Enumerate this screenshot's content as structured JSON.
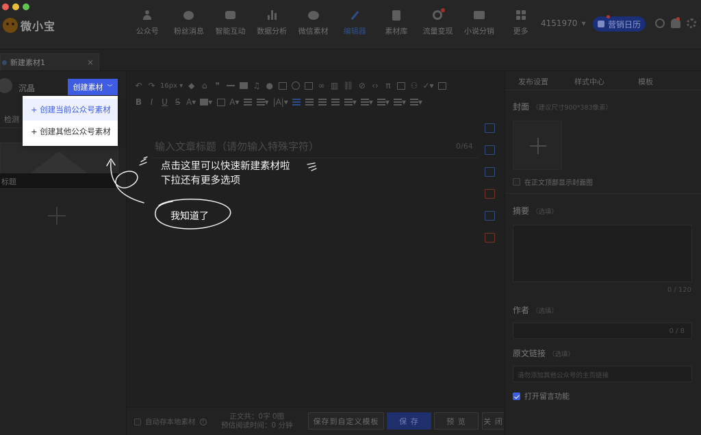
{
  "app": {
    "logo_text": "微小宝",
    "nav": [
      {
        "label": "公众号",
        "icon": "person-icon"
      },
      {
        "label": "粉丝消息",
        "icon": "bubble-icon"
      },
      {
        "label": "智能互动",
        "icon": "chat-icon"
      },
      {
        "label": "数据分析",
        "icon": "bar-chart-icon"
      },
      {
        "label": "微信素材",
        "icon": "wechat-icon"
      },
      {
        "label": "编辑器",
        "icon": "pen-icon",
        "active": true
      },
      {
        "label": "素材库",
        "icon": "book-icon"
      },
      {
        "label": "流量变现",
        "icon": "money-icon"
      },
      {
        "label": "小说分销",
        "icon": "open-book-icon"
      },
      {
        "label": "更多",
        "icon": "grid-icon"
      }
    ],
    "account_id": "4151970",
    "calendar_label": "营销日历"
  },
  "tabs": {
    "doc_tab_label": "新建素材1",
    "close_glyph": "×"
  },
  "left_panel": {
    "account_name": "沉晶",
    "create_button_label": "创建素材",
    "dropdown": [
      {
        "label": "+ 创建当前公众号素材",
        "active": true
      },
      {
        "label": "+ 创建其他公众号素材",
        "active": false
      }
    ],
    "detect_tab_label": "检测",
    "card_title": "标题"
  },
  "editor": {
    "font_size": "16px",
    "title_placeholder": "输入文章标题（请勿输入特殊字符）",
    "title_counter": "0/64"
  },
  "right_panel": {
    "tabs": [
      "发布设置",
      "样式中心",
      "模板"
    ],
    "cover_label": "封面",
    "cover_hint": "（建议尺寸900*383像素）",
    "show_cover_label": "在正文顶部显示封面图",
    "summary_label": "摘要",
    "summary_hint": "（选填）",
    "summary_count": "0 / 120",
    "author_label": "作者",
    "author_hint": "（选填）",
    "author_count": "0 / 8",
    "link_label": "原文链接",
    "link_hint": "（选填）",
    "link_placeholder": "请勿添加其他公众号的主页链接",
    "comments_label": "打开留言功能"
  },
  "bottom_bar": {
    "autosave_label": "自动存本地素材",
    "autosave_help": "?",
    "stats_line1": "正文共：0字 0图",
    "stats_line2": "预估阅读时间：0 分钟",
    "save_template_label": "保存到自定义模板",
    "save_label": "保 存",
    "preview_label": "预 览",
    "close_label": "关 闭"
  },
  "onboarding": {
    "tip_line1": "点击这里可以快速新建素材啦",
    "tip_line2": "下拉还有更多选项",
    "confirm_label": "我知道了"
  },
  "colors": {
    "accent": "#3e5de4",
    "background": "#1f1f1f",
    "dropdown_highlight": "#edf1ff"
  }
}
